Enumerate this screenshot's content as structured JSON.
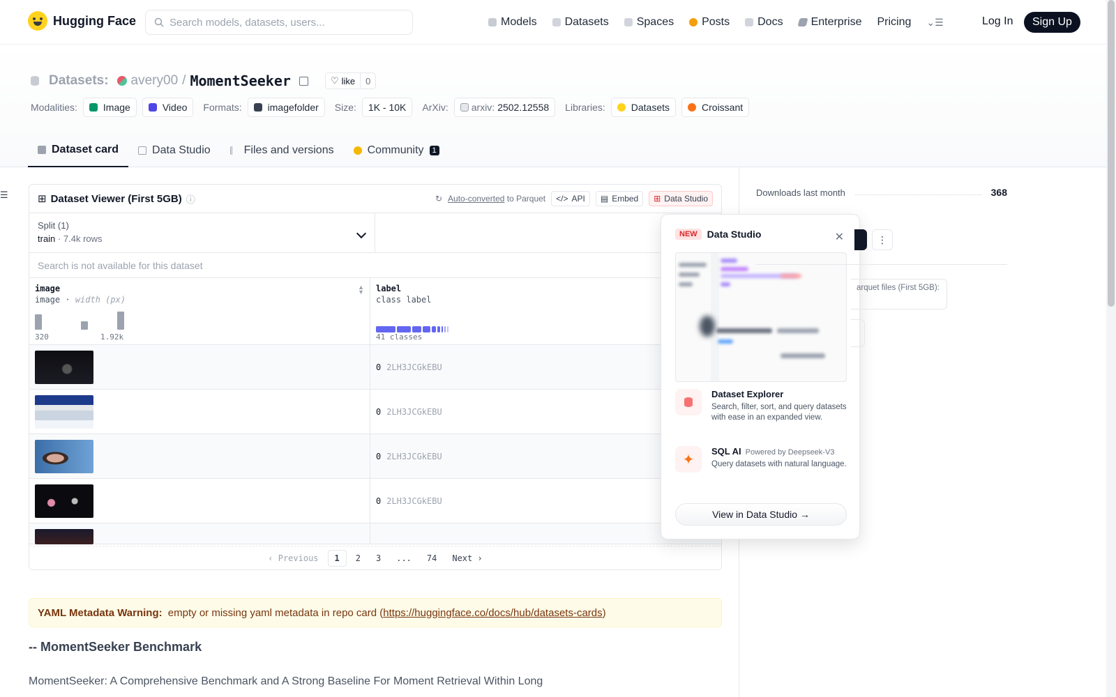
{
  "header": {
    "brand": "Hugging Face",
    "search_placeholder": "Search models, datasets, users...",
    "nav": [
      "Models",
      "Datasets",
      "Spaces",
      "Posts",
      "Docs",
      "Enterprise",
      "Pricing"
    ],
    "nav_icons": [
      "cube-icon",
      "database-icon",
      "grid-icon",
      "posts-icon",
      "book-icon",
      "enterprise-icon"
    ],
    "login": "Log In",
    "signup": "Sign Up"
  },
  "repo": {
    "type_label": "Datasets:",
    "owner": "avery00",
    "separator": "/",
    "name": "MomentSeeker",
    "like_label": "like",
    "like_count": "0",
    "tags": {
      "modalities_label": "Modalities:",
      "modalities": [
        "Image",
        "Video"
      ],
      "formats_label": "Formats:",
      "format": "imagefolder",
      "size_label": "Size:",
      "size": "1K - 10K",
      "arxiv_label": "ArXiv:",
      "arxiv_prefix": "arxiv:",
      "arxiv_id": "2502.12558",
      "libraries_label": "Libraries:",
      "libraries": [
        "Datasets",
        "Croissant"
      ]
    },
    "tabs": [
      "Dataset card",
      "Data Studio",
      "Files and versions",
      "Community"
    ],
    "community_badge": "1"
  },
  "viewer": {
    "title": "Dataset Viewer (First 5GB)",
    "auto_converted": "Auto-converted",
    "to_parquet": "to Parquet",
    "api": "API",
    "embed": "Embed",
    "data_studio": "Data Studio",
    "split_label": "Split (1)",
    "split_value": "train",
    "split_rows": "7.4k rows",
    "search_disabled": "Search is not available for this dataset",
    "columns": [
      {
        "name": "image",
        "type": "image",
        "stat": "width (px)",
        "min": "320",
        "max": "1.92k"
      },
      {
        "name": "label",
        "type": "class label",
        "classes": "41 classes"
      }
    ],
    "rows": [
      {
        "label": "0",
        "label_name": "2LH3JCGkEBU"
      },
      {
        "label": "0",
        "label_name": "2LH3JCGkEBU"
      },
      {
        "label": "0",
        "label_name": "2LH3JCGkEBU"
      },
      {
        "label": "0",
        "label_name": "2LH3JCGkEBU"
      }
    ],
    "pager": {
      "prev": "Previous",
      "pages": [
        "1",
        "2",
        "3",
        "...",
        "74"
      ],
      "next": "Next",
      "current": "1"
    }
  },
  "popup": {
    "badge": "NEW",
    "title": "Data Studio",
    "features": [
      {
        "title": "Dataset Explorer",
        "subtitle": "",
        "desc": "Search, filter, sort, and query datasets with ease in an expanded view."
      },
      {
        "title": "SQL AI",
        "subtitle": "Powered by Deepseek-V3",
        "desc": "Query datasets with natural language."
      }
    ],
    "cta": "View in Data Studio →"
  },
  "sidebar": {
    "downloads_label": "Downloads last month",
    "downloads_value": "368",
    "parquet_text": "arquet files (First 5GB):"
  },
  "card": {
    "warning_label": "YAML Metadata Warning:",
    "warning_text": " empty or missing yaml metadata in repo card (",
    "warning_link": "https://huggingface.co/docs/hub/datasets-cards",
    "warning_close": ")",
    "heading": "-- MomentSeeker Benchmark",
    "paragraph": "MomentSeeker: A Comprehensive Benchmark and A Strong Baseline For Moment Retrieval Within Long"
  },
  "colors": {
    "accent": "#ffd21e",
    "dark": "#0b1120",
    "class_bar": "#6366f1"
  }
}
